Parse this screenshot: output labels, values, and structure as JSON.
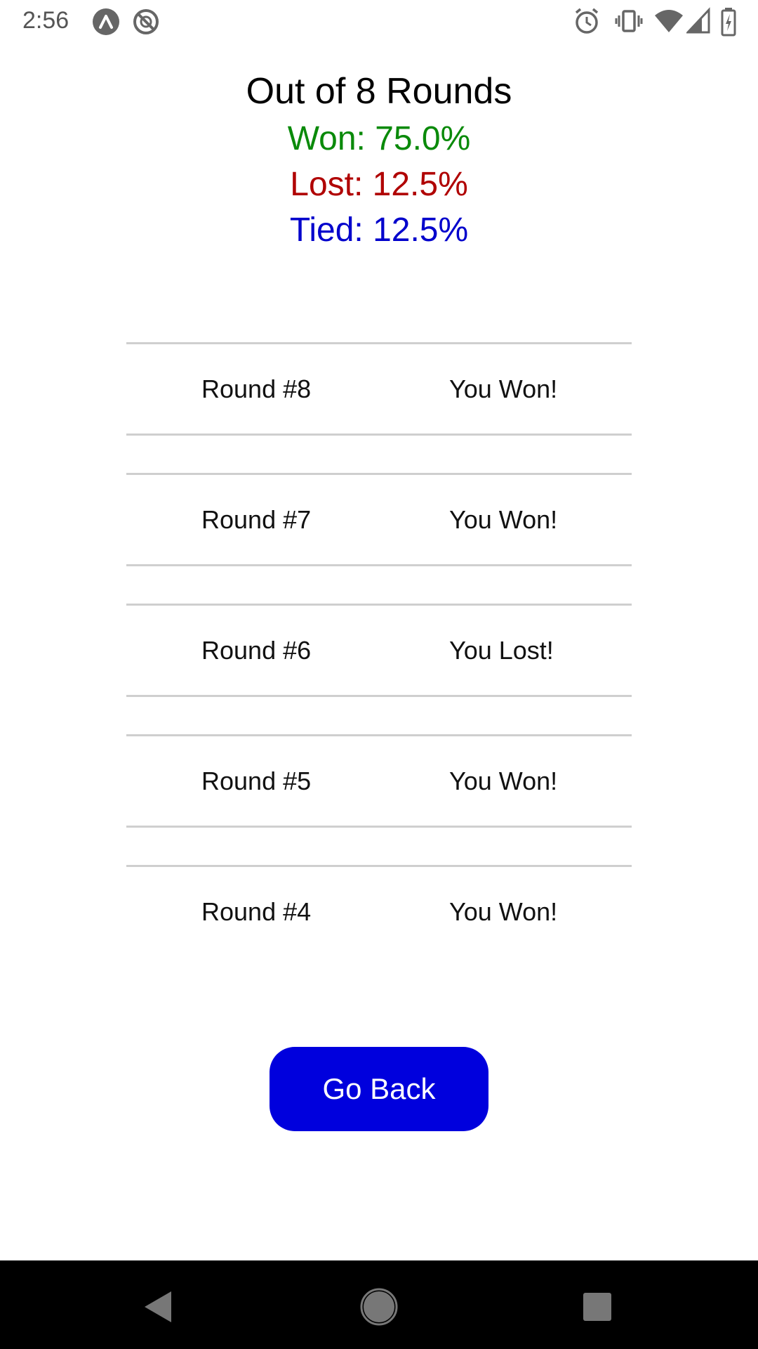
{
  "status_bar": {
    "time": "2:56",
    "left_icons": [
      "accessibility-app-icon",
      "no-sync-icon"
    ],
    "right_icons": [
      "alarm-icon",
      "vibrate-icon",
      "wifi-icon",
      "signal-icon",
      "battery-charging-icon"
    ]
  },
  "summary": {
    "title": "Out of 8 Rounds",
    "won": "Won: 75.0%",
    "lost": "Lost: 12.5%",
    "tied": "Tied: 12.5%",
    "colors": {
      "won": "#0a8a0a",
      "lost": "#b00000",
      "tied": "#0000cc"
    }
  },
  "rounds": [
    {
      "label": "Round #8",
      "result": "You Won!"
    },
    {
      "label": "Round #7",
      "result": "You Won!"
    },
    {
      "label": "Round #6",
      "result": "You Lost!"
    },
    {
      "label": "Round #5",
      "result": "You Won!"
    },
    {
      "label": "Round #4",
      "result": "You Won!"
    }
  ],
  "actions": {
    "go_back_label": "Go Back",
    "button_color": "#0000dd"
  },
  "nav_bar": {
    "buttons": [
      "back-triangle-icon",
      "home-circle-icon",
      "recents-square-icon"
    ]
  }
}
